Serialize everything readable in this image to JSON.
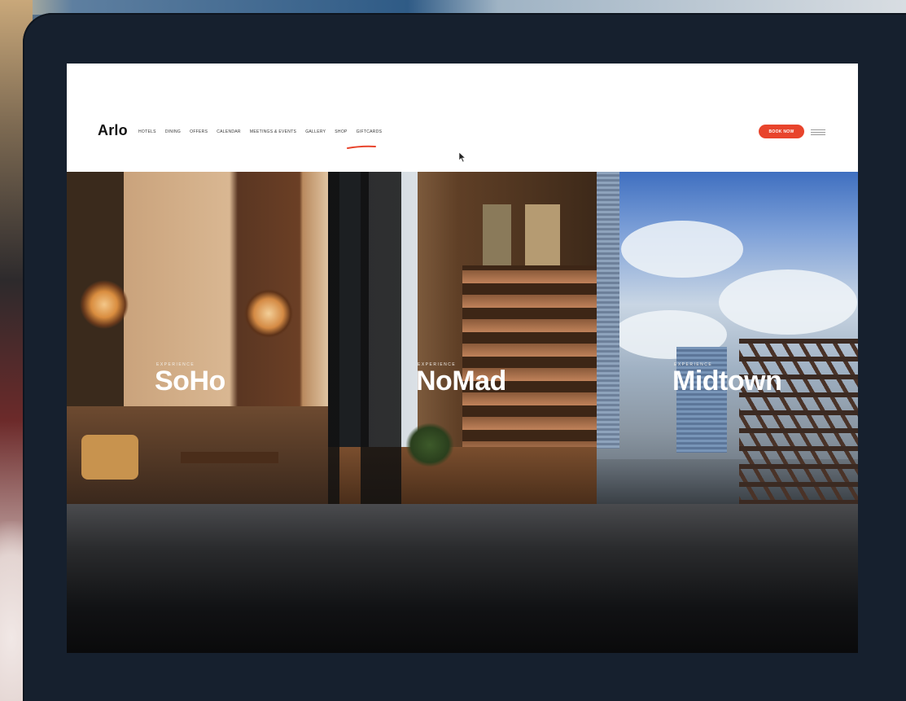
{
  "site": {
    "logo": "Arlo",
    "nav_items": [
      "HOTELS",
      "DINING",
      "OFFERS",
      "CALENDAR",
      "MEETINGS & EVENTS",
      "GALLERY",
      "SHOP",
      "GIFTCARDS"
    ],
    "book_label": "BOOK NOW",
    "menu_label": "MENU"
  },
  "hero": {
    "panels": [
      {
        "eyebrow": "EXPERIENCE",
        "title": "SoHo"
      },
      {
        "eyebrow": "EXPERIENCE",
        "title": "NoMad"
      },
      {
        "eyebrow": "EXPERIENCE",
        "title": "Midtown"
      }
    ]
  },
  "colors": {
    "accent": "#e8442c",
    "header_bg": "#ffffff",
    "tablet_frame": "#16202e"
  },
  "icons": {
    "cursor": "mouse-cursor-icon",
    "menu": "hamburger-menu-icon"
  }
}
